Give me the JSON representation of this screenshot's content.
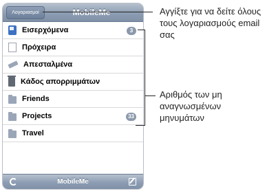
{
  "navbar": {
    "back_label": "Λογαριασμοί",
    "title": "MobileMe"
  },
  "mailboxes": [
    {
      "label": "Εισερχόμενα",
      "icon": "inbox-icon",
      "badge": "3"
    },
    {
      "label": "Πρόχειρα",
      "icon": "document-icon",
      "badge": ""
    },
    {
      "label": "Απεσταλμένα",
      "icon": "sent-icon",
      "badge": ""
    },
    {
      "label": "Κάδος απορριμμάτων",
      "icon": "trash-icon",
      "badge": ""
    },
    {
      "label": "Friends",
      "icon": "folder-icon",
      "badge": ""
    },
    {
      "label": "Projects",
      "icon": "folder-icon",
      "badge": "33"
    },
    {
      "label": "Travel",
      "icon": "folder-icon",
      "badge": ""
    }
  ],
  "toolbar": {
    "title": "MobileMe",
    "refresh_icon": "refresh-icon",
    "compose_icon": "compose-icon"
  },
  "callouts": {
    "accounts": "Αγγίξτε για να δείτε όλους τους λογαριασμούς email σας",
    "unread": "Αριθμός των μη αναγνωσμένων μηνυμάτων"
  }
}
